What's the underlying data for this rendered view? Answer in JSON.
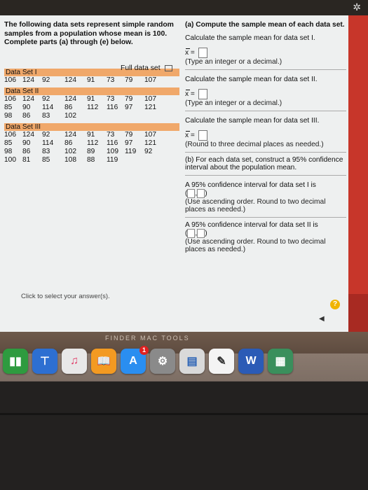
{
  "left": {
    "intro": "The following data sets represent simple random samples from a population whose mean is 100. Complete parts (a) through (e) below.",
    "full_data_label": "Full data set",
    "data_set_1": {
      "title": "Data Set I",
      "rows": [
        [
          "106",
          "124",
          "92",
          "124",
          "91",
          "73",
          "79",
          "107"
        ]
      ]
    },
    "data_set_2": {
      "title": "Data Set II",
      "rows": [
        [
          "106",
          "124",
          "92",
          "124",
          "91",
          "73",
          "79",
          "107"
        ],
        [
          "85",
          "90",
          "114",
          "86",
          "112",
          "116",
          "97",
          "121"
        ],
        [
          "98",
          "86",
          "83",
          "102",
          "",
          "",
          "",
          ""
        ]
      ]
    },
    "data_set_3": {
      "title": "Data Set III",
      "rows": [
        [
          "106",
          "124",
          "92",
          "124",
          "91",
          "73",
          "79",
          "107"
        ],
        [
          "85",
          "90",
          "114",
          "86",
          "112",
          "116",
          "97",
          "121"
        ],
        [
          "98",
          "86",
          "83",
          "102",
          "89",
          "109",
          "119",
          "92"
        ],
        [
          "100",
          "81",
          "85",
          "108",
          "88",
          "119",
          "",
          ""
        ]
      ]
    },
    "click_select": "Click to select your answer(s)."
  },
  "right": {
    "part_a": "(a) Compute the sample mean of each data set.",
    "calc_1": "Calculate the sample mean for data set I.",
    "xeq": "x =",
    "hint_int": "(Type an integer or a decimal.)",
    "calc_2": "Calculate the sample mean for data set II.",
    "calc_3": "Calculate the sample mean for data set III.",
    "hint_round3": "(Round to three decimal places as needed.)",
    "part_b": "(b) For each data set, construct a 95% confidence interval about the population mean.",
    "ci_1": "A 95% confidence interval for data set I is",
    "ci_hint": "(Use ascending order. Round to two decimal places as needed.)",
    "ci_2": "A 95% confidence interval for data set II is",
    "ci_hint_2": "(Use ascending order. Round to two decimal places as needed.)"
  },
  "ui": {
    "help_label": "?",
    "nav_prev": "◀",
    "gear": "✲"
  },
  "dock": {
    "label": "FINDER MAC TOOLS",
    "badge": "1",
    "colors": {
      "numbers": "#2e9b3f",
      "keynote": "#2d6fd1",
      "itunes": "#e8e8e8",
      "ibooks": "#f39a22",
      "appstore": "#2a8ef0",
      "settings": "#8a8a8a",
      "preview": "#d9d9d9",
      "textedit": "#f4f4f4",
      "word": "#2b5bb6",
      "other": "#3a8f5c"
    }
  }
}
